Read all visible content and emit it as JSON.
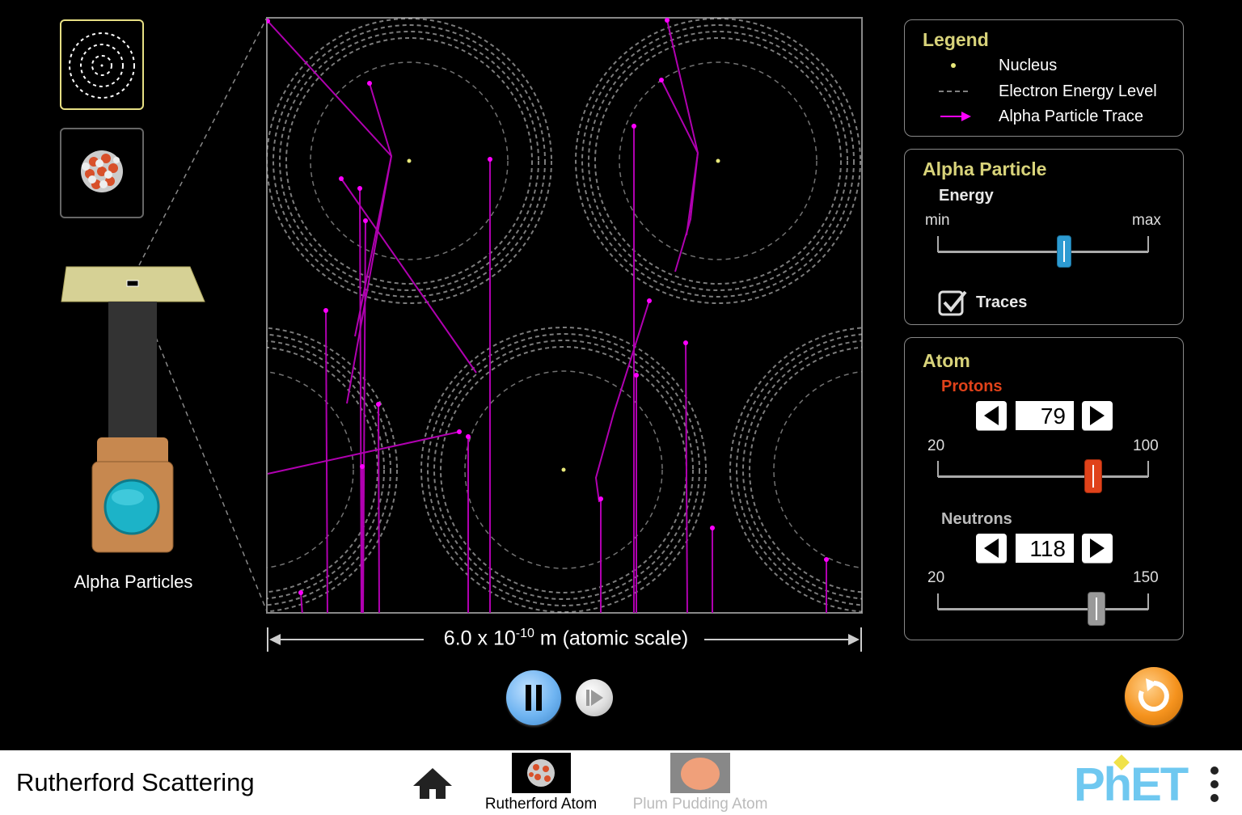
{
  "app_title": "Rutherford Scattering",
  "source": {
    "label": "Alpha Particles"
  },
  "scale": {
    "base": "6.0 x 10",
    "exponent": "-10",
    "unit": "m (atomic scale)"
  },
  "legend": {
    "title": "Legend",
    "items": [
      {
        "label": "Nucleus",
        "icon": "nucleus-dot-icon"
      },
      {
        "label": "Electron Energy Level",
        "icon": "dashed-line-icon"
      },
      {
        "label": "Alpha Particle Trace",
        "icon": "magenta-arrow-icon"
      }
    ]
  },
  "alpha_particle": {
    "title": "Alpha Particle",
    "energy_label": "Energy",
    "min_label": "min",
    "max_label": "max",
    "energy_level": 0.6,
    "traces_label": "Traces",
    "traces_checked": true
  },
  "atom": {
    "title": "Atom",
    "protons": {
      "label": "Protons",
      "value": "79",
      "min": "20",
      "max": "100"
    },
    "neutrons": {
      "label": "Neutrons",
      "value": "118",
      "min": "20",
      "max": "150"
    }
  },
  "nav": {
    "home_icon": "home-icon",
    "screens": [
      {
        "label": "Rutherford Atom",
        "active": true
      },
      {
        "label": "Plum Pudding Atom",
        "active": false
      }
    ],
    "brand": "PhET"
  },
  "colors": {
    "panel_title": "#d8d37a",
    "protons": "#e0421a",
    "trace": "#ff00ff",
    "nucleus": "#e8e87a",
    "energy_thumb": "#2d9bd2",
    "proton_thumb": "#e0421a",
    "neutron_thumb": "#999999",
    "reset": "#f5931e",
    "pause": "#6fb4f1"
  }
}
